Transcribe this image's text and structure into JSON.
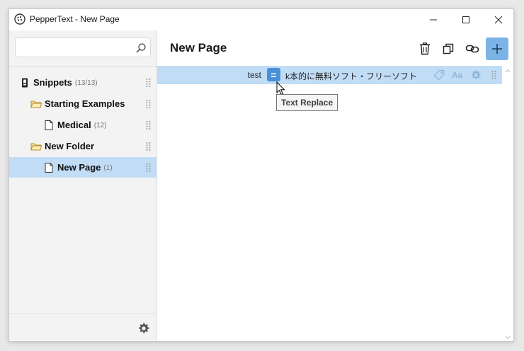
{
  "window": {
    "title": "PepperText - New Page"
  },
  "search": {
    "placeholder": "",
    "value": ""
  },
  "sidebar": {
    "items": [
      {
        "label": "Snippets",
        "count": "(13/13)",
        "icon": "snippets-icon",
        "level": 0,
        "selected": false
      },
      {
        "label": "Starting Examples",
        "count": "",
        "icon": "folder-icon",
        "level": 1,
        "selected": false
      },
      {
        "label": "Medical",
        "count": "(12)",
        "icon": "page-icon",
        "level": 2,
        "selected": false
      },
      {
        "label": "New Folder",
        "count": "",
        "icon": "folder-icon",
        "level": 1,
        "selected": false
      },
      {
        "label": "New Page",
        "count": "(1)",
        "icon": "page-icon",
        "level": 2,
        "selected": true
      }
    ]
  },
  "main": {
    "page_title": "New Page",
    "snippet": {
      "trigger": "test",
      "type_symbol": "=",
      "replacement": "k本的に無料ソフト・フリーソフト",
      "case_label": "Aa"
    },
    "tooltip": "Text Replace"
  },
  "colors": {
    "accent": "#4a90d9",
    "selection": "#c1dcf5",
    "add_button": "#7bb3e6",
    "folder": "#c8a03c"
  }
}
